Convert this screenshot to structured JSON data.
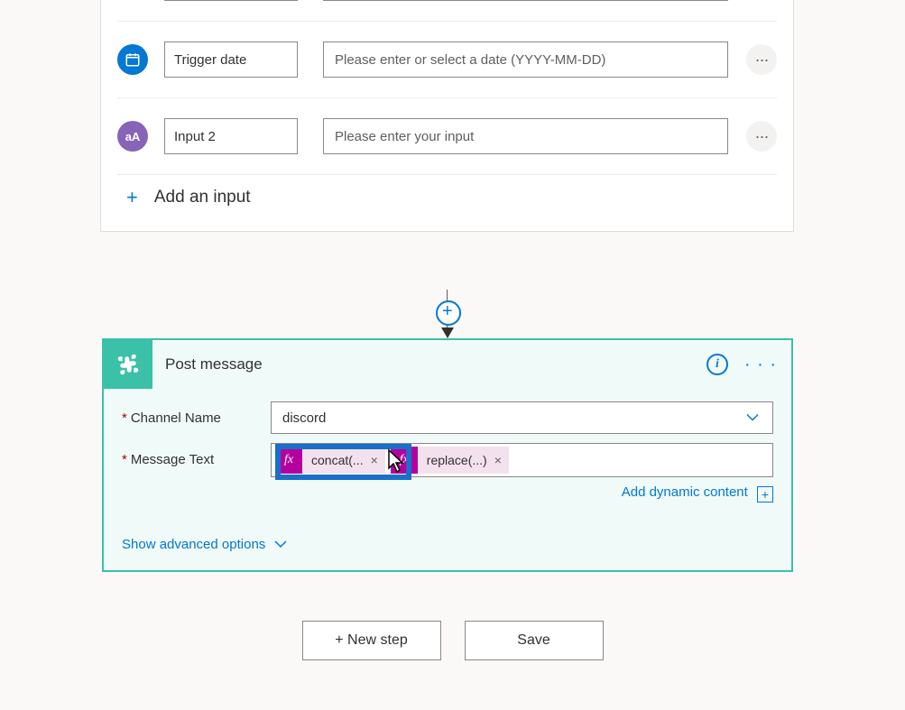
{
  "trigger": {
    "inputs": [
      {
        "label": "",
        "placeholder": ""
      },
      {
        "label": "Trigger date",
        "placeholder": "Please enter or select a date (YYYY-MM-DD)"
      },
      {
        "label": "Input 2",
        "placeholder": "Please enter your input"
      }
    ],
    "add_input_label": "Add an input"
  },
  "action": {
    "title": "Post message",
    "fields": {
      "channel_label": "Channel Name",
      "channel_value": "discord",
      "message_label": "Message Text",
      "tokens": [
        {
          "text": "concat(..."
        },
        {
          "text": "replace(...)"
        }
      ]
    },
    "dynamic_link": "Add dynamic content",
    "advanced_link": "Show advanced options"
  },
  "buttons": {
    "new_step": "+ New step",
    "save": "Save"
  }
}
